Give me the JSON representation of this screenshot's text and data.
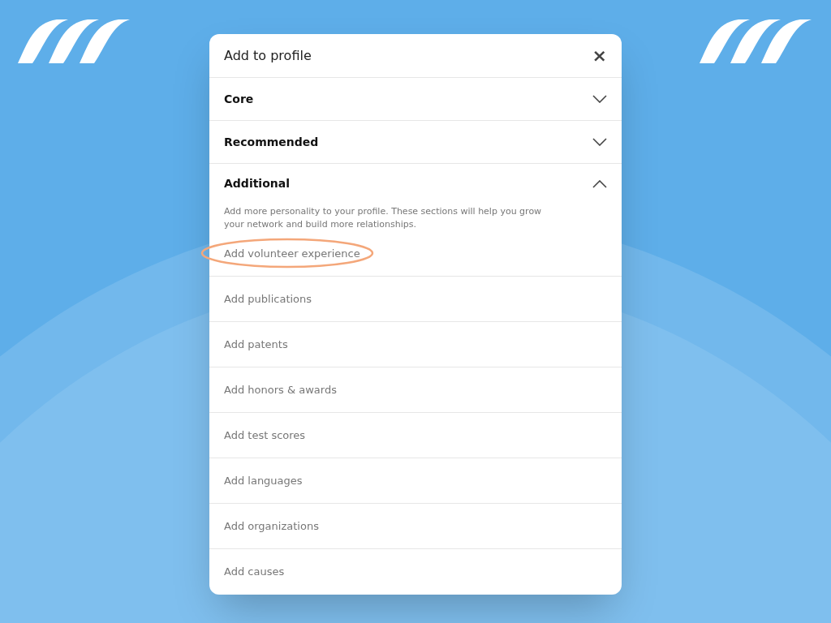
{
  "dialog": {
    "title": "Add to profile",
    "close": "×"
  },
  "sections": [
    {
      "title": "Core",
      "expanded": false
    },
    {
      "title": "Recommended",
      "expanded": false
    },
    {
      "title": "Additional",
      "expanded": true,
      "description": "Add more personality to your profile. These sections will help you  grow your network and build more relationships.",
      "items": [
        {
          "label": "Add volunteer experience",
          "highlighted": true
        },
        {
          "label": "Add publications",
          "highlighted": false
        },
        {
          "label": "Add patents",
          "highlighted": false
        },
        {
          "label": "Add honors & awards",
          "highlighted": false
        },
        {
          "label": "Add test scores",
          "highlighted": false
        },
        {
          "label": "Add languages",
          "highlighted": false
        },
        {
          "label": "Add organizations",
          "highlighted": false
        },
        {
          "label": "Add causes",
          "highlighted": false
        }
      ]
    }
  ]
}
